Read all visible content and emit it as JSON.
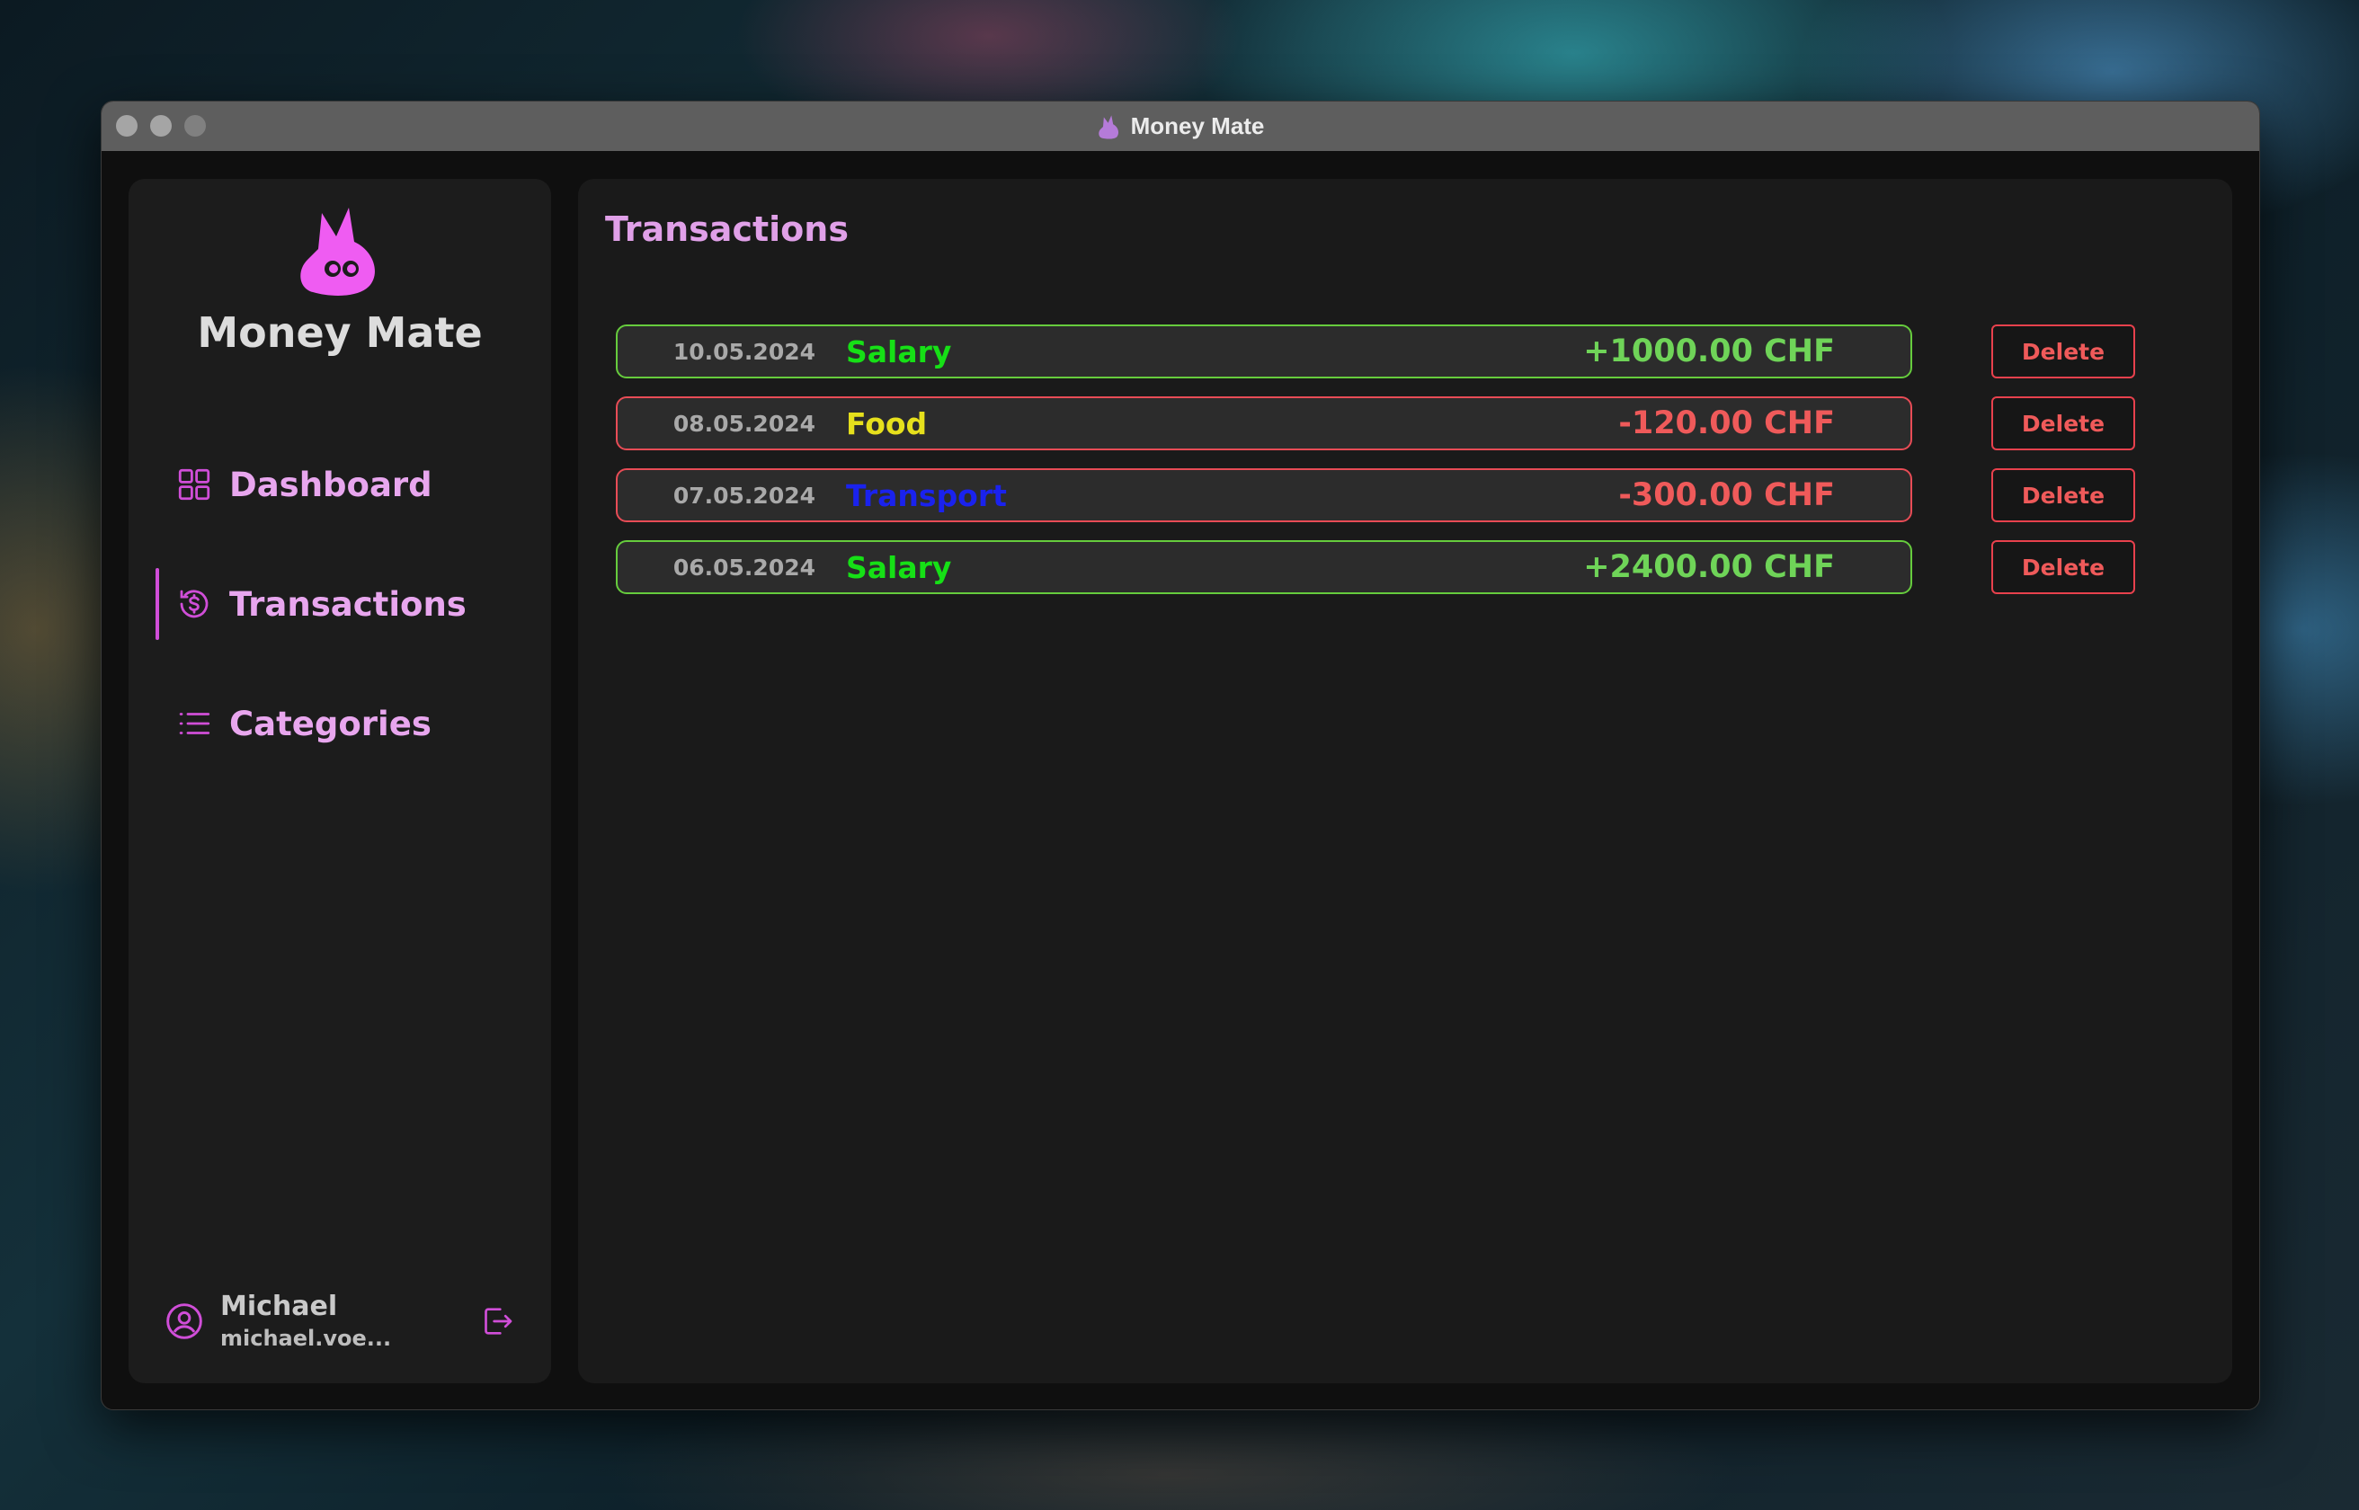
{
  "window": {
    "title": "Money Mate"
  },
  "sidebar": {
    "app_name": "Money Mate",
    "items": [
      {
        "label": "Dashboard",
        "icon": "grid-icon"
      },
      {
        "label": "Transactions",
        "icon": "dollar-history-icon",
        "active": true
      },
      {
        "label": "Categories",
        "icon": "list-icon"
      }
    ],
    "user": {
      "name": "Michael",
      "email": "michael.voe..."
    }
  },
  "main": {
    "title": "Transactions",
    "delete_label": "Delete",
    "transactions": [
      {
        "date": "10.05.2024",
        "category": "Salary",
        "category_color": "#16e016",
        "amount": "+1000.00 CHF",
        "type": "income"
      },
      {
        "date": "08.05.2024",
        "category": "Food",
        "category_color": "#e6e01c",
        "amount": "-120.00 CHF",
        "type": "expense"
      },
      {
        "date": "07.05.2024",
        "category": "Transport",
        "category_color": "#1a22ee",
        "amount": "-300.00 CHF",
        "type": "expense"
      },
      {
        "date": "06.05.2024",
        "category": "Salary",
        "category_color": "#16e016",
        "amount": "+2400.00 CHF",
        "type": "income"
      }
    ]
  },
  "colors": {
    "accent": "#d04ed8",
    "nav_text": "#e8a6ee",
    "income_border": "#66cc3d",
    "expense_border": "#e84c56",
    "positive_amount": "#6fd458",
    "negative_amount": "#ef5a5a"
  }
}
